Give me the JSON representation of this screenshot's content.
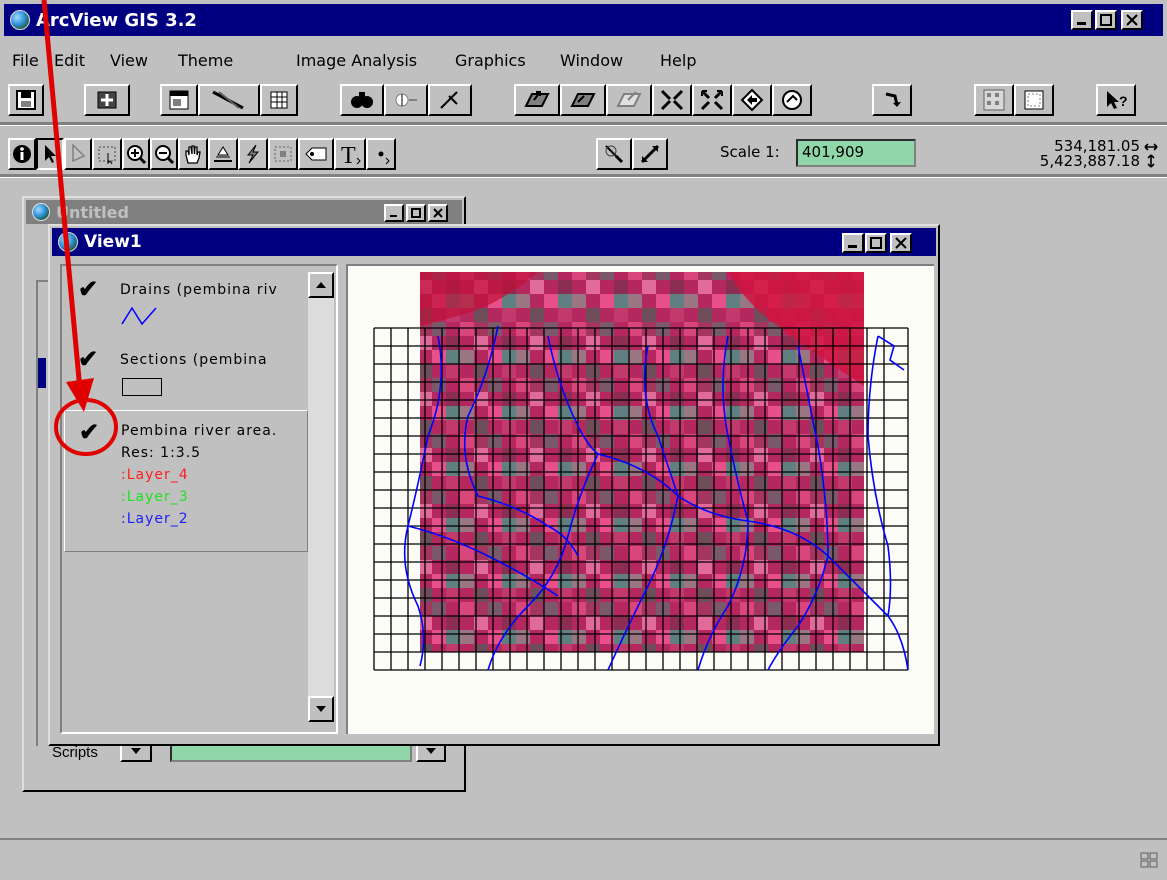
{
  "app": {
    "title": "ArcView GIS 3.2"
  },
  "menu": [
    "File",
    "Edit",
    "View",
    "Theme",
    "Image Analysis",
    "Graphics",
    "Window",
    "Help"
  ],
  "toolbar_icons": [
    "save-icon",
    "add-theme-icon",
    "theme-properties-icon",
    "edit-legend-icon",
    "open-table-icon",
    "find-icon",
    "locate-icon",
    "query-builder-icon",
    "zoom-full-extent-icon",
    "zoom-to-themes-icon",
    "zoom-to-selected-icon",
    "zoom-in-fixed-icon",
    "zoom-out-fixed-icon",
    "zoom-previous-icon",
    "clear-selected-icon",
    "hot-link-icon",
    "layout-icon",
    "print-preview-icon",
    "help-icon"
  ],
  "tools_icons": [
    "identify-icon",
    "pointer-icon",
    "vertex-edit-icon",
    "select-feature-icon",
    "zoom-in-icon",
    "zoom-out-icon",
    "pan-icon",
    "measure-icon",
    "hotlink-tool-icon",
    "area-of-interest-icon",
    "label-icon",
    "text-icon",
    "draw-point-icon",
    "magnify-icon",
    "line-tool-icon"
  ],
  "scale": {
    "label": "Scale 1:",
    "value": "401,909"
  },
  "coordinates": {
    "x": "534,181.05",
    "y": "5,423,887.18"
  },
  "project_window": {
    "title": "Untitled",
    "scripts_label": "Scripts"
  },
  "view_window": {
    "title": "View1",
    "themes": [
      {
        "name": "Drains (pembina riv",
        "checked": true,
        "symbol": "line"
      },
      {
        "name": "Sections (pembina",
        "checked": true,
        "symbol": "polygon"
      },
      {
        "name": "Pembina river area.",
        "checked": true,
        "symbol": "image",
        "res": "Res: 1:3.5",
        "layers": [
          {
            "label": ":Layer_4",
            "color": "#ff2020"
          },
          {
            "label": ":Layer_3",
            "color": "#20e020"
          },
          {
            "label": ":Layer_2",
            "color": "#2020ff"
          }
        ]
      }
    ]
  },
  "colors": {
    "title_bar": "#000080",
    "window_face": "#c0c0c0",
    "scale_field": "#8fd6a8",
    "drains_line": "#0000ff",
    "annotation_red": "#e00000"
  }
}
